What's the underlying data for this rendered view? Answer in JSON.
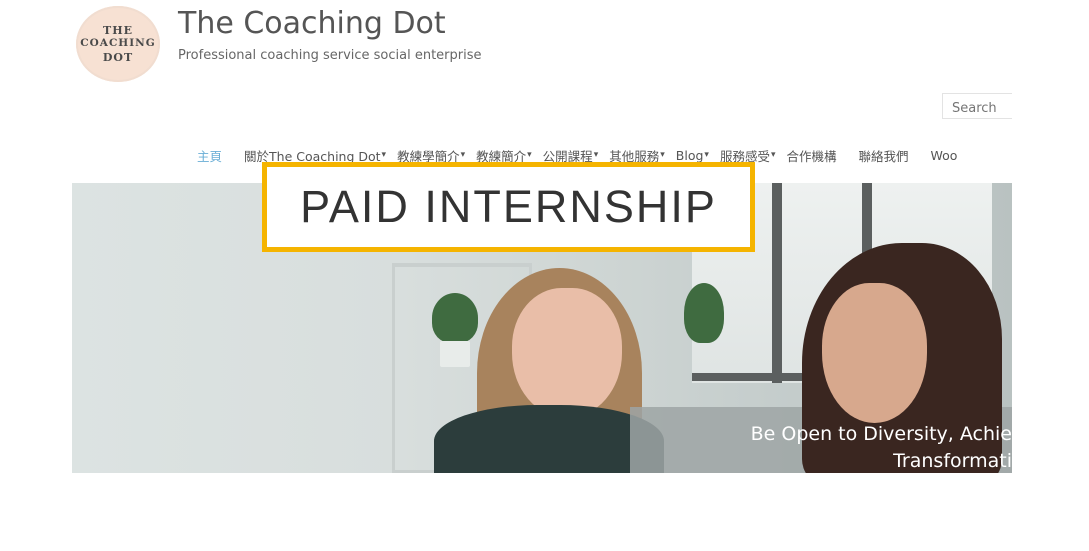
{
  "site": {
    "logo_lines": [
      "THE",
      "COACHING",
      "DOT"
    ],
    "title": "The Coaching Dot",
    "tagline": "Professional coaching service social enterprise"
  },
  "search": {
    "placeholder": "Search"
  },
  "nav": {
    "items": [
      {
        "label": "主頁",
        "has_dropdown": false
      },
      {
        "label": "關於The Coaching Dot",
        "has_dropdown": true
      },
      {
        "label": "教練學簡介",
        "has_dropdown": true
      },
      {
        "label": "教練簡介",
        "has_dropdown": true
      },
      {
        "label": "公開課程",
        "has_dropdown": true
      },
      {
        "label": "其他服務",
        "has_dropdown": true
      },
      {
        "label": "Blog",
        "has_dropdown": true
      },
      {
        "label": "服務感受",
        "has_dropdown": true
      },
      {
        "label": "合作機構",
        "has_dropdown": false
      },
      {
        "label": "聯絡我們",
        "has_dropdown": false
      },
      {
        "label": "Woo",
        "has_dropdown": false
      }
    ],
    "active_color": "#6aaed6",
    "caret_glyph": "▾"
  },
  "banner": {
    "text": "PAID INTERNSHIP",
    "border_color": "#f5b400"
  },
  "hero": {
    "caption_line1": "Be Open to Diversity, Achie",
    "caption_line2": "Transformati"
  }
}
